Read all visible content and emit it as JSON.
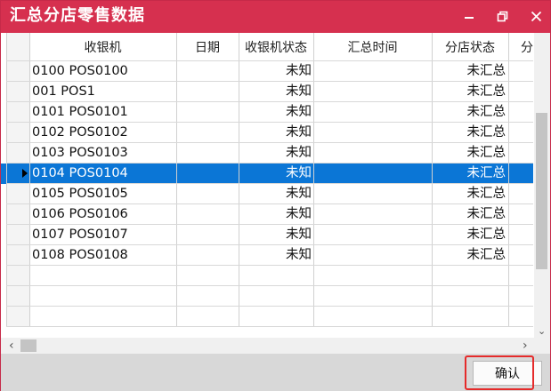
{
  "window": {
    "title": "汇总分店零售数据"
  },
  "titlebar_buttons": {
    "minimize": "minimize-icon",
    "restore": "restore-icon",
    "close": "close-icon"
  },
  "table": {
    "columns": [
      "收银机",
      "日期",
      "收银机状态",
      "汇总时间",
      "分店状态",
      "分"
    ],
    "rows": [
      {
        "pos": "0100 POS0100",
        "date": "",
        "pos_status": "未知",
        "summary_time": "",
        "store_status": "未汇总"
      },
      {
        "pos": "001 POS1",
        "date": "",
        "pos_status": "未知",
        "summary_time": "",
        "store_status": "未汇总"
      },
      {
        "pos": "0101 POS0101",
        "date": "",
        "pos_status": "未知",
        "summary_time": "",
        "store_status": "未汇总"
      },
      {
        "pos": "0102 POS0102",
        "date": "",
        "pos_status": "未知",
        "summary_time": "",
        "store_status": "未汇总"
      },
      {
        "pos": "0103 POS0103",
        "date": "",
        "pos_status": "未知",
        "summary_time": "",
        "store_status": "未汇总"
      },
      {
        "pos": "0104 POS0104",
        "date": "",
        "pos_status": "未知",
        "summary_time": "",
        "store_status": "未汇总"
      },
      {
        "pos": "0105 POS0105",
        "date": "",
        "pos_status": "未知",
        "summary_time": "",
        "store_status": "未汇总"
      },
      {
        "pos": "0106 POS0106",
        "date": "",
        "pos_status": "未知",
        "summary_time": "",
        "store_status": "未汇总"
      },
      {
        "pos": "0107 POS0107",
        "date": "",
        "pos_status": "未知",
        "summary_time": "",
        "store_status": "未汇总"
      },
      {
        "pos": "0108 POS0108",
        "date": "",
        "pos_status": "未知",
        "summary_time": "",
        "store_status": "未汇总"
      }
    ],
    "selected_index": 5
  },
  "scrollbars": {
    "left_arrow": "‹",
    "right_arrow": "›",
    "down_arrow": "⌄"
  },
  "footer": {
    "confirm_label": "确认"
  }
}
